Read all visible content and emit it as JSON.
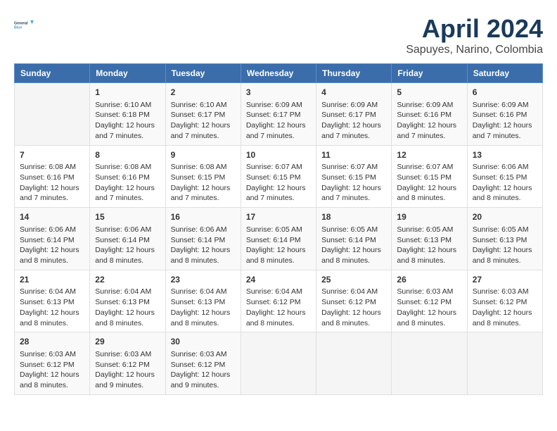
{
  "header": {
    "logo_line1": "General",
    "logo_line2": "Blue",
    "title": "April 2024",
    "subtitle": "Sapuyes, Narino, Colombia"
  },
  "columns": [
    "Sunday",
    "Monday",
    "Tuesday",
    "Wednesday",
    "Thursday",
    "Friday",
    "Saturday"
  ],
  "weeks": [
    [
      {
        "day": "",
        "info": ""
      },
      {
        "day": "1",
        "info": "Sunrise: 6:10 AM\nSunset: 6:18 PM\nDaylight: 12 hours\nand 7 minutes."
      },
      {
        "day": "2",
        "info": "Sunrise: 6:10 AM\nSunset: 6:17 PM\nDaylight: 12 hours\nand 7 minutes."
      },
      {
        "day": "3",
        "info": "Sunrise: 6:09 AM\nSunset: 6:17 PM\nDaylight: 12 hours\nand 7 minutes."
      },
      {
        "day": "4",
        "info": "Sunrise: 6:09 AM\nSunset: 6:17 PM\nDaylight: 12 hours\nand 7 minutes."
      },
      {
        "day": "5",
        "info": "Sunrise: 6:09 AM\nSunset: 6:16 PM\nDaylight: 12 hours\nand 7 minutes."
      },
      {
        "day": "6",
        "info": "Sunrise: 6:09 AM\nSunset: 6:16 PM\nDaylight: 12 hours\nand 7 minutes."
      }
    ],
    [
      {
        "day": "7",
        "info": "Sunrise: 6:08 AM\nSunset: 6:16 PM\nDaylight: 12 hours\nand 7 minutes."
      },
      {
        "day": "8",
        "info": "Sunrise: 6:08 AM\nSunset: 6:16 PM\nDaylight: 12 hours\nand 7 minutes."
      },
      {
        "day": "9",
        "info": "Sunrise: 6:08 AM\nSunset: 6:15 PM\nDaylight: 12 hours\nand 7 minutes."
      },
      {
        "day": "10",
        "info": "Sunrise: 6:07 AM\nSunset: 6:15 PM\nDaylight: 12 hours\nand 7 minutes."
      },
      {
        "day": "11",
        "info": "Sunrise: 6:07 AM\nSunset: 6:15 PM\nDaylight: 12 hours\nand 7 minutes."
      },
      {
        "day": "12",
        "info": "Sunrise: 6:07 AM\nSunset: 6:15 PM\nDaylight: 12 hours\nand 8 minutes."
      },
      {
        "day": "13",
        "info": "Sunrise: 6:06 AM\nSunset: 6:15 PM\nDaylight: 12 hours\nand 8 minutes."
      }
    ],
    [
      {
        "day": "14",
        "info": "Sunrise: 6:06 AM\nSunset: 6:14 PM\nDaylight: 12 hours\nand 8 minutes."
      },
      {
        "day": "15",
        "info": "Sunrise: 6:06 AM\nSunset: 6:14 PM\nDaylight: 12 hours\nand 8 minutes."
      },
      {
        "day": "16",
        "info": "Sunrise: 6:06 AM\nSunset: 6:14 PM\nDaylight: 12 hours\nand 8 minutes."
      },
      {
        "day": "17",
        "info": "Sunrise: 6:05 AM\nSunset: 6:14 PM\nDaylight: 12 hours\nand 8 minutes."
      },
      {
        "day": "18",
        "info": "Sunrise: 6:05 AM\nSunset: 6:14 PM\nDaylight: 12 hours\nand 8 minutes."
      },
      {
        "day": "19",
        "info": "Sunrise: 6:05 AM\nSunset: 6:13 PM\nDaylight: 12 hours\nand 8 minutes."
      },
      {
        "day": "20",
        "info": "Sunrise: 6:05 AM\nSunset: 6:13 PM\nDaylight: 12 hours\nand 8 minutes."
      }
    ],
    [
      {
        "day": "21",
        "info": "Sunrise: 6:04 AM\nSunset: 6:13 PM\nDaylight: 12 hours\nand 8 minutes."
      },
      {
        "day": "22",
        "info": "Sunrise: 6:04 AM\nSunset: 6:13 PM\nDaylight: 12 hours\nand 8 minutes."
      },
      {
        "day": "23",
        "info": "Sunrise: 6:04 AM\nSunset: 6:13 PM\nDaylight: 12 hours\nand 8 minutes."
      },
      {
        "day": "24",
        "info": "Sunrise: 6:04 AM\nSunset: 6:12 PM\nDaylight: 12 hours\nand 8 minutes."
      },
      {
        "day": "25",
        "info": "Sunrise: 6:04 AM\nSunset: 6:12 PM\nDaylight: 12 hours\nand 8 minutes."
      },
      {
        "day": "26",
        "info": "Sunrise: 6:03 AM\nSunset: 6:12 PM\nDaylight: 12 hours\nand 8 minutes."
      },
      {
        "day": "27",
        "info": "Sunrise: 6:03 AM\nSunset: 6:12 PM\nDaylight: 12 hours\nand 8 minutes."
      }
    ],
    [
      {
        "day": "28",
        "info": "Sunrise: 6:03 AM\nSunset: 6:12 PM\nDaylight: 12 hours\nand 8 minutes."
      },
      {
        "day": "29",
        "info": "Sunrise: 6:03 AM\nSunset: 6:12 PM\nDaylight: 12 hours\nand 9 minutes."
      },
      {
        "day": "30",
        "info": "Sunrise: 6:03 AM\nSunset: 6:12 PM\nDaylight: 12 hours\nand 9 minutes."
      },
      {
        "day": "",
        "info": ""
      },
      {
        "day": "",
        "info": ""
      },
      {
        "day": "",
        "info": ""
      },
      {
        "day": "",
        "info": ""
      }
    ]
  ]
}
